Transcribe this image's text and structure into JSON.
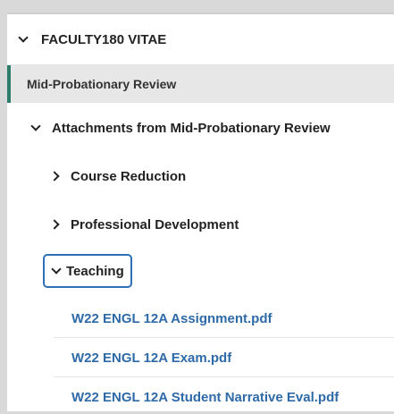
{
  "vitae": {
    "title": "FACULTY180 VITAE"
  },
  "section": {
    "title": "Mid-Probationary Review"
  },
  "attachments": {
    "title": "Attachments from Mid-Probationary Review",
    "folders": [
      {
        "label": "Course Reduction",
        "expanded": false
      },
      {
        "label": "Professional Development",
        "expanded": false
      },
      {
        "label": "Teaching",
        "expanded": true
      }
    ],
    "files": [
      "W22 ENGL 12A Assignment.pdf",
      "W22 ENGL 12A Exam.pdf",
      "W22 ENGL 12A Student Narrative Eval.pdf"
    ]
  },
  "colors": {
    "accent_bar": "#2e7d68",
    "focus_border": "#2f6fb5",
    "link": "#2f6aa8"
  },
  "icons": {
    "collapse": "chevron-down-icon",
    "expand": "chevron-right-icon"
  }
}
